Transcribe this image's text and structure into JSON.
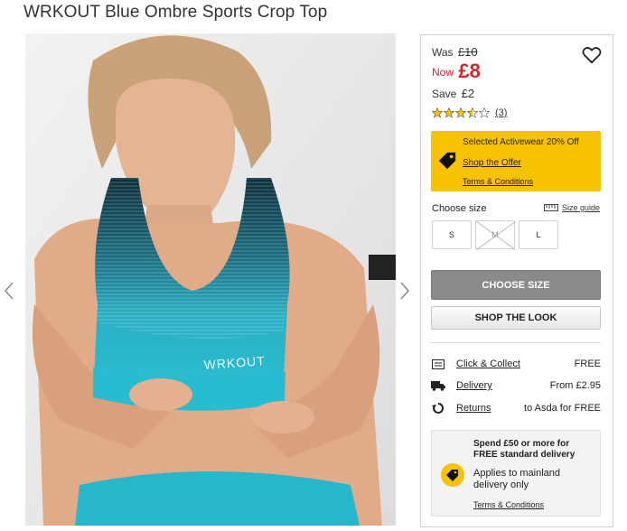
{
  "product": {
    "title": "WRKOUT Blue Ombre Sports Crop Top"
  },
  "gallery": {
    "image_text": "WRKOUT",
    "prev_icon": "chevron-left-icon",
    "next_icon": "chevron-right-icon"
  },
  "price": {
    "was_label": "Was",
    "was_value": "£10",
    "now_label": "Now",
    "now_value": "£8",
    "save_label": "Save",
    "save_value": "£2",
    "now_color": "#d6242a"
  },
  "wishlist": {
    "icon": "heart-icon"
  },
  "rating": {
    "stars": 3.5,
    "max": 5,
    "count": "(3)",
    "star_color": "#f7c300"
  },
  "offer": {
    "title": "Selected Activewear 20% Off",
    "link": "Shop the Offer",
    "terms": "Terms & Conditions",
    "background": "#f7c300",
    "icon": "tag-icon"
  },
  "size": {
    "label": "Choose size",
    "guide": "Size guide",
    "guide_icon": "ruler-icon",
    "options": [
      {
        "label": "S",
        "available": true
      },
      {
        "label": "M",
        "available": false
      },
      {
        "label": "L",
        "available": true
      }
    ]
  },
  "buttons": {
    "choose_size": "CHOOSE SIZE",
    "shop_look": "SHOP THE LOOK"
  },
  "delivery": [
    {
      "icon": "store-icon",
      "label": "Click & Collect",
      "value": "FREE"
    },
    {
      "icon": "truck-icon",
      "label": "Delivery",
      "value": "From £2.95"
    },
    {
      "icon": "returns-icon",
      "label": "Returns",
      "value": "to Asda for FREE"
    }
  ],
  "promo": {
    "title_line1": "Spend £50 or more for",
    "title_line2": "FREE standard delivery",
    "body_line1": "Applies to mainland",
    "body_line2": "delivery only",
    "terms": "Terms & Conditions",
    "icon": "tag-icon"
  }
}
